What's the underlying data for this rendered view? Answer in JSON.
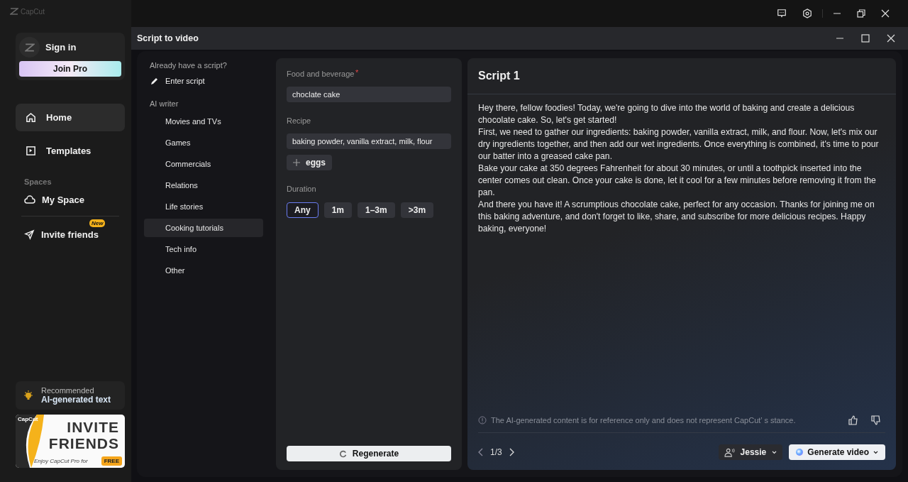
{
  "app": {
    "logo_text": "CapCut"
  },
  "account": {
    "sign_in": "Sign in",
    "join_pro": "Join Pro"
  },
  "nav": [
    {
      "label": "Home",
      "kind": "home",
      "selected": true
    },
    {
      "label": "Templates",
      "kind": "templates",
      "selected": false
    }
  ],
  "spaces": {
    "heading": "Spaces",
    "items": [
      {
        "label": "My Space",
        "kind": "cloud"
      }
    ]
  },
  "invite": {
    "label": "Invite friends",
    "badge": "New"
  },
  "recommended": {
    "caption": "Recommended",
    "title": "AI-generated text"
  },
  "banner": {
    "brand": "CapCut",
    "line1": "INVITE",
    "line2": "FRIENDS",
    "tagline": "Enjoy CapCut Pro for",
    "tag": "FREE"
  },
  "dialog": {
    "title": "Script to video"
  },
  "script_nav": {
    "heading": "Already have a script?",
    "enter": "Enter script",
    "ai_heading": "AI writer",
    "items": [
      {
        "label": "Movies and TVs",
        "selected": false
      },
      {
        "label": "Games",
        "selected": false
      },
      {
        "label": "Commercials",
        "selected": false
      },
      {
        "label": "Relations",
        "selected": false
      },
      {
        "label": "Life stories",
        "selected": false
      },
      {
        "label": "Cooking tutorials",
        "selected": true
      },
      {
        "label": "Tech info",
        "selected": false
      },
      {
        "label": "Other",
        "selected": false
      }
    ]
  },
  "form": {
    "topic_label": "Food and beverage",
    "required_mark": "*",
    "topic_value": "choclate cake",
    "recipe_label": "Recipe",
    "recipe_value": "baking powder, vanilla extract, milk, flour",
    "add_chip": "eggs",
    "duration_label": "Duration",
    "durations": [
      {
        "label": "Any",
        "selected": true
      },
      {
        "label": "1m",
        "selected": false
      },
      {
        "label": "1–3m",
        "selected": false
      },
      {
        "label": ">3m",
        "selected": false
      }
    ],
    "regenerate": "Regenerate"
  },
  "script": {
    "title": "Script 1",
    "paragraphs": [
      "Hey there, fellow foodies! Today, we're going to dive into the world of baking and create a delicious chocolate cake. So, let's get started!",
      "First, we need to gather our ingredients: baking powder, vanilla extract, milk, and flour. Now, let's mix our dry ingredients together, and then add our wet ingredients. Once everything is combined, it's time to pour our batter into a greased cake pan.",
      "Bake your cake at 350 degrees Fahrenheit for about 30 minutes, or until a toothpick inserted into the center comes out clean. Once your cake is done, let it cool for a few minutes before removing it from the pan.",
      "And there you have it! A scrumptious chocolate cake, perfect for any occasion. Thanks for joining me on this baking adventure, and don't forget to like, share, and subscribe for more delicious recipes. Happy baking, everyone!"
    ],
    "disclaimer": "The AI-generated content is for reference only and does not represent CapCut’ s stance.",
    "page": "1/3",
    "voice": "Jessie",
    "generate": "Generate video"
  }
}
